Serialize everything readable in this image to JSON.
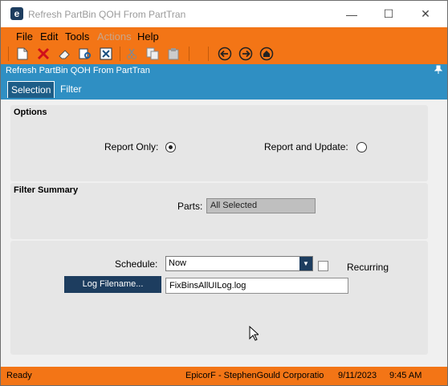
{
  "window": {
    "app_icon_letter": "e",
    "title": "Refresh PartBin QOH From PartTran",
    "controls": {
      "minimize": "—",
      "maximize": "☐",
      "close": "✕"
    }
  },
  "menu": {
    "items": [
      {
        "label": "File",
        "enabled": true
      },
      {
        "label": "Edit",
        "enabled": true
      },
      {
        "label": "Tools",
        "enabled": true
      },
      {
        "label": "Actions",
        "enabled": false
      },
      {
        "label": "Help",
        "enabled": true
      }
    ]
  },
  "toolbar": {
    "icons": [
      "new-doc-icon",
      "delete-x-icon",
      "eraser-icon",
      "print-preview-icon",
      "generate-icon",
      "cut-icon",
      "copy-icon",
      "paste-icon",
      "back-icon",
      "forward-icon",
      "home-icon"
    ]
  },
  "header": {
    "title": "Refresh PartBin QOH From PartTran",
    "pin": "📌"
  },
  "tabs": [
    {
      "label": "Selection",
      "active": true
    },
    {
      "label": "Filter",
      "active": false
    }
  ],
  "options": {
    "title": "Options",
    "report_only_label": "Report Only:",
    "report_only_selected": true,
    "report_update_label": "Report and Update:",
    "report_update_selected": false
  },
  "filter_summary": {
    "title": "Filter Summary",
    "parts_label": "Parts:",
    "parts_value": "All Selected"
  },
  "schedule": {
    "schedule_label": "Schedule:",
    "schedule_value": "Now",
    "recurring_label": "Recurring",
    "recurring_checked": false,
    "log_button_label": "Log Filename...",
    "log_filename_value": "FixBinsAllUILog.log"
  },
  "status": {
    "state": "Ready",
    "company": "EpicorF - StephenGould Corporatio",
    "date": "9/11/2023",
    "time": "9:45 AM"
  },
  "colors": {
    "accent_orange": "#f37516",
    "header_blue": "#2f8fc3",
    "button_navy": "#1d3d5f"
  }
}
